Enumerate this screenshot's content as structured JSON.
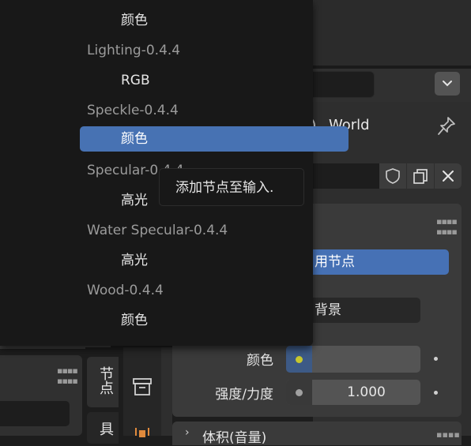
{
  "colors": {
    "accent": "#4772b3",
    "menu_bg": "#181818",
    "panel_bg": "#3a3a3a",
    "socket_yellow": "#c7c72e"
  },
  "popup_menu": {
    "items": [
      {
        "kind": "item",
        "label": "颜色"
      },
      {
        "kind": "header",
        "label": "Lighting-0.4.4"
      },
      {
        "kind": "item",
        "label": "RGB"
      },
      {
        "kind": "header",
        "label": "Speckle-0.4.4"
      },
      {
        "kind": "selected",
        "label": "颜色"
      },
      {
        "kind": "header",
        "label": "Specular-0.4.4"
      },
      {
        "kind": "item",
        "label": "高光"
      },
      {
        "kind": "header",
        "label": "Water Specular-0.4.4"
      },
      {
        "kind": "item",
        "label": "高光"
      },
      {
        "kind": "header",
        "label": "Wood-0.4.4"
      },
      {
        "kind": "item",
        "label": "颜色"
      }
    ]
  },
  "tooltip": {
    "text": "添加节点至输入."
  },
  "properties": {
    "world_name": "World",
    "world_icon": "world-icon",
    "pin_icon": "pin-icon",
    "fake_user_icon": "shield-icon",
    "duplicate_icon": "duplicate-icon",
    "unlink_icon": "close-icon",
    "use_nodes_label": "用节点",
    "surface_value": "背景",
    "color_label": "颜色",
    "strength_label": "强度/力度",
    "strength_value": "1.000",
    "volume_label": "体积(音量)"
  },
  "side_tabs": {
    "node_tab": "节点",
    "tool_tab": "具"
  }
}
